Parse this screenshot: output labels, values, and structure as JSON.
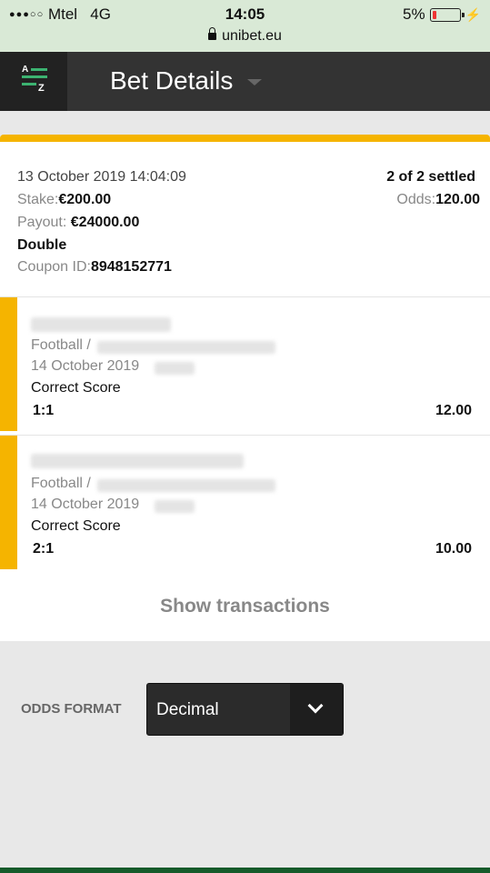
{
  "status_bar": {
    "carrier": "Mtel",
    "network": "4G",
    "time": "14:05",
    "battery": "5%",
    "url": "unibet.eu"
  },
  "header": {
    "sort_icon_label_top": "A",
    "sort_icon_label_bottom": "Z",
    "title": "Bet Details"
  },
  "bet": {
    "placed": "13 October 2019 14:04:09",
    "status": "2 of 2 settled",
    "stake_label": "Stake:",
    "stake": "€200.00",
    "odds_label": "Odds:",
    "odds": "120.00",
    "payout_label": "Payout:",
    "payout": "€24000.00",
    "type": "Double",
    "coupon_label": "Coupon ID:",
    "coupon_id": "8948152771",
    "accent_color": "#f5b400"
  },
  "legs": [
    {
      "sport": "Football /",
      "date": "14 October 2019",
      "market": "Correct Score",
      "selection": "1:1",
      "odds": "12.00"
    },
    {
      "sport": "Football /",
      "date": "14 October 2019",
      "market": "Correct Score",
      "selection": "2:1",
      "odds": "10.00"
    }
  ],
  "actions": {
    "show_transactions": "Show transactions"
  },
  "odds_format": {
    "label": "ODDS FORMAT",
    "selected": "Decimal"
  }
}
